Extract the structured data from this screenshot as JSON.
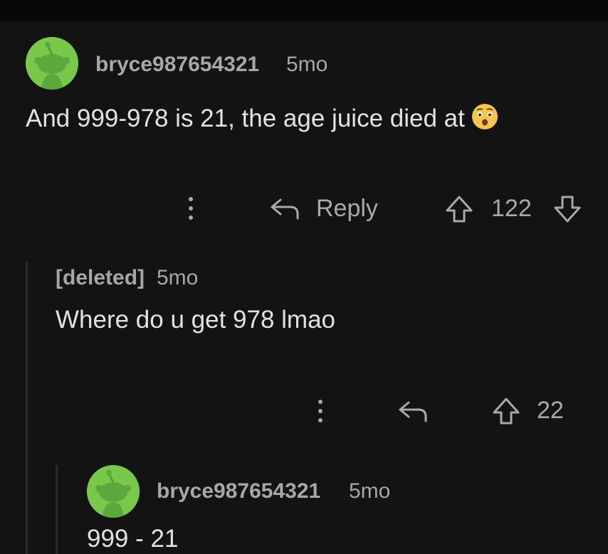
{
  "comments": [
    {
      "username": "bryce987654321",
      "age": "5mo",
      "body": "And 999-978 is 21, the age juice died at",
      "emoji": "anxious-face-emoji",
      "actions": {
        "reply_label": "Reply",
        "score": "122"
      }
    },
    {
      "username": "[deleted]",
      "age": "5mo",
      "body": "Where do u get 978 lmao",
      "actions": {
        "score": "22"
      }
    },
    {
      "username": "bryce987654321",
      "age": "5mo",
      "body": "999 - 21"
    }
  ],
  "colors": {
    "background": "#131313",
    "avatar_green": "#78c84a",
    "text": "#e2e2e2",
    "muted": "#a7a7a7"
  },
  "icons": [
    "avatar-icon",
    "more-options-icon",
    "reply-icon",
    "upvote-icon",
    "downvote-icon"
  ]
}
